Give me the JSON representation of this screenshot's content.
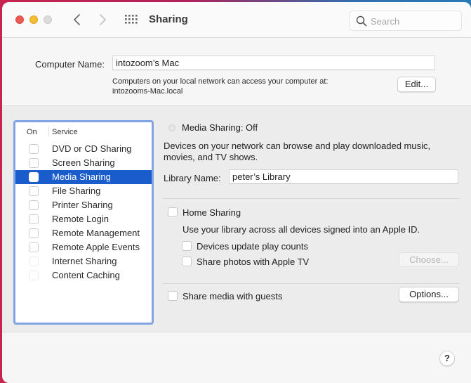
{
  "window": {
    "title": "Sharing",
    "traffic_lights": [
      "close",
      "minimize",
      "zoom"
    ],
    "nav": {
      "back_icon": "chevron-left-icon",
      "forward_icon": "chevron-right-icon",
      "grid_icon": "grid-icon"
    },
    "search": {
      "placeholder": "Search",
      "value": ""
    }
  },
  "computer_name": {
    "label": "Computer Name:",
    "value": "intozoom’s Mac",
    "help_line1": "Computers on your local network can access your computer at:",
    "help_line2": "intozooms-Mac.local",
    "edit_button": "Edit..."
  },
  "services": {
    "header_on": "On",
    "header_service": "Service",
    "items": [
      {
        "name": "DVD or CD Sharing",
        "checked": false,
        "selected": false,
        "disabled": false
      },
      {
        "name": "Screen Sharing",
        "checked": false,
        "selected": false,
        "disabled": false
      },
      {
        "name": "Media Sharing",
        "checked": false,
        "selected": true,
        "disabled": false
      },
      {
        "name": "File Sharing",
        "checked": false,
        "selected": false,
        "disabled": false
      },
      {
        "name": "Printer Sharing",
        "checked": false,
        "selected": false,
        "disabled": false
      },
      {
        "name": "Remote Login",
        "checked": false,
        "selected": false,
        "disabled": false
      },
      {
        "name": "Remote Management",
        "checked": false,
        "selected": false,
        "disabled": false
      },
      {
        "name": "Remote Apple Events",
        "checked": false,
        "selected": false,
        "disabled": false
      },
      {
        "name": "Internet Sharing",
        "checked": false,
        "selected": false,
        "disabled": true
      },
      {
        "name": "Content Caching",
        "checked": false,
        "selected": false,
        "disabled": true
      }
    ]
  },
  "detail": {
    "status": "Media Sharing: Off",
    "description": "Devices on your network can browse and play downloaded music, movies, and TV shows.",
    "library_label": "Library Name:",
    "library_value": "peter’s Library",
    "home_sharing_label": "Home Sharing",
    "home_sharing_desc": "Use your library across all devices signed into an Apple ID.",
    "update_play_counts_label": "Devices update play counts",
    "share_photos_label": "Share photos with Apple TV",
    "choose_button": "Choose...",
    "share_guests_label": "Share media with guests",
    "options_button": "Options..."
  },
  "help_button": "?",
  "colors": {
    "selection": "#1a5ccc",
    "focus_ring": "#7fa4e3",
    "close": "#ee5b55",
    "minimize": "#f5bd30",
    "zoom_disabled": "#dcdcdc"
  }
}
